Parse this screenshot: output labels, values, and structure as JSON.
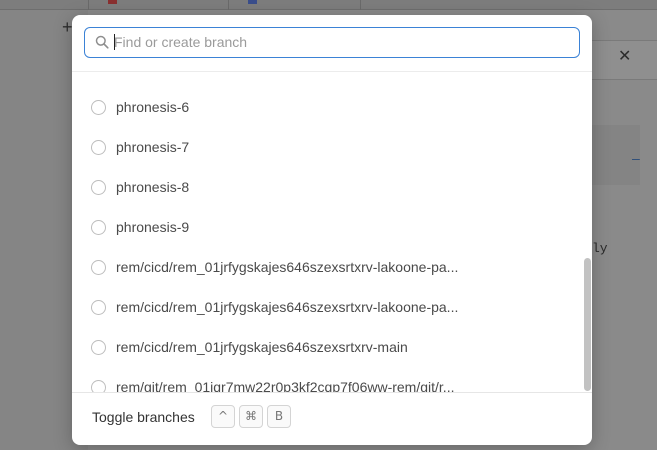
{
  "search": {
    "placeholder": "Find or create branch",
    "value": ""
  },
  "branches": [
    "phronesis-6",
    "phronesis-7",
    "phronesis-8",
    "phronesis-9",
    "rem/cicd/rem_01jrfygskajes646szexsrtxrv-lakoone-pa...",
    "rem/cicd/rem_01jrfygskajes646szexsrtxrv-lakoone-pa...",
    "rem/cicd/rem_01jrfygskajes646szexsrtxrv-main",
    "rem/git/rem_01jqr7mw22r0p3kf2cqp7f06ww-rem/git/r..."
  ],
  "footer": {
    "toggle_label": "Toggle branches",
    "shortcut_keys": [
      "^",
      "⌘",
      "B"
    ]
  },
  "background": {
    "partial_text": "ly"
  },
  "colors": {
    "focus_ring": "#3b82d6",
    "overlay": "#8a8a8a"
  }
}
